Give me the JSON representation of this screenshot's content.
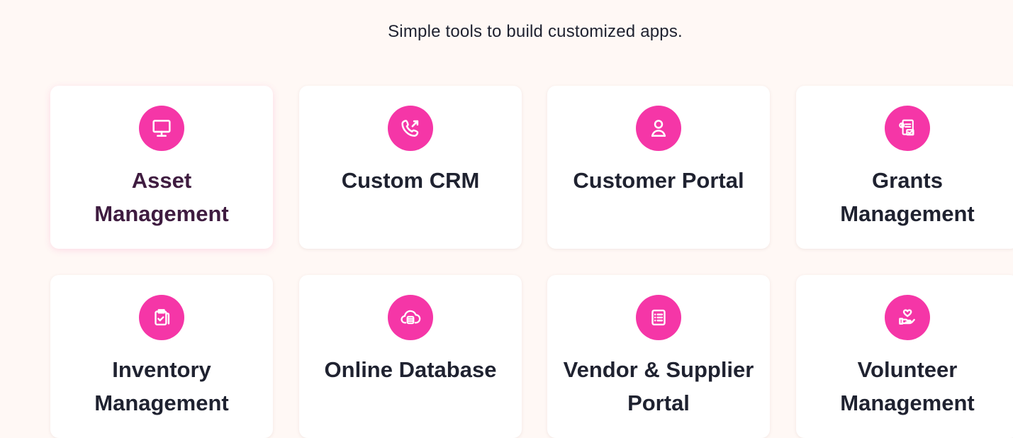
{
  "section": {
    "subtitle": "Simple tools to build customized apps."
  },
  "cards": [
    {
      "title": "Asset Management",
      "icon": "monitor-icon",
      "active": true
    },
    {
      "title": "Custom CRM",
      "icon": "phone-call-icon",
      "active": false
    },
    {
      "title": "Customer Portal",
      "icon": "user-icon",
      "active": false
    },
    {
      "title": "Grants Management",
      "icon": "grant-document-icon",
      "active": false
    },
    {
      "title": "Inventory Management",
      "icon": "clipboard-check-icon",
      "active": false
    },
    {
      "title": "Online Database",
      "icon": "cloud-database-icon",
      "active": false
    },
    {
      "title": "Vendor & Supplier Portal",
      "icon": "list-document-icon",
      "active": false
    },
    {
      "title": "Volunteer Management",
      "icon": "hand-heart-icon",
      "active": false
    }
  ],
  "colors": {
    "background": "#fff8f5",
    "card": "#ffffff",
    "accent": "#f536a7",
    "text": "#1f2230",
    "active_text": "#3f1c40"
  }
}
